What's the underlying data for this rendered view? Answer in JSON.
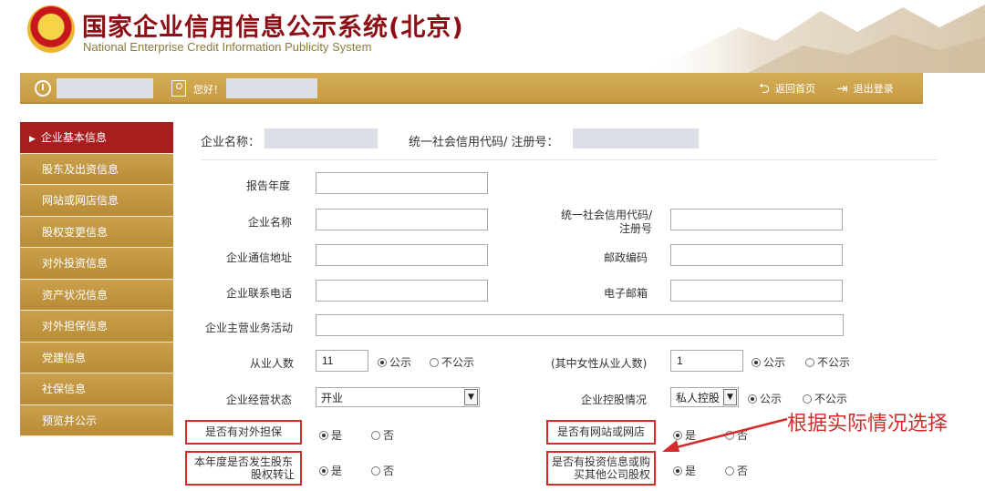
{
  "header": {
    "title_cn": "国家企业信用信息公示系统(北京)",
    "title_en": "National Enterprise Credit Information Publicity System"
  },
  "topbar": {
    "hello": "您好！",
    "home_label": "返回首页",
    "logout_label": "退出登录"
  },
  "sidebar": {
    "items": [
      {
        "label": "企业基本信息",
        "active": true
      },
      {
        "label": "股东及出资信息"
      },
      {
        "label": "网站或网店信息"
      },
      {
        "label": "股权变更信息"
      },
      {
        "label": "对外投资信息"
      },
      {
        "label": "资产状况信息"
      },
      {
        "label": "对外担保信息"
      },
      {
        "label": "党建信息"
      },
      {
        "label": "社保信息"
      },
      {
        "label": "预览并公示"
      }
    ]
  },
  "info": {
    "company_name_label": "企业名称：",
    "credit_code_label": "统一社会信用代码/ 注册号："
  },
  "form": {
    "report_year": {
      "label": "报告年度",
      "value": ""
    },
    "company_name": {
      "label": "企业名称",
      "value": ""
    },
    "credit_code": {
      "label_line1": "统一社会信用代码/",
      "label_line2": "注册号",
      "value": ""
    },
    "address": {
      "label": "企业通信地址",
      "value": ""
    },
    "postcode": {
      "label": "邮政编码",
      "value": ""
    },
    "phone": {
      "label": "企业联系电话",
      "value": ""
    },
    "email": {
      "label": "电子邮箱",
      "value": ""
    },
    "main_business": {
      "label": "企业主营业务活动",
      "value": ""
    },
    "employees": {
      "label": "从业人数",
      "value": "11",
      "public": "公示",
      "not_public": "不公示"
    },
    "female_employees": {
      "label": "(其中女性从业人数)",
      "value": "1",
      "public": "公示",
      "not_public": "不公示"
    },
    "status": {
      "label": "企业经营状态",
      "value": "开业"
    },
    "holding": {
      "label": "企业控股情况",
      "value": "私人控股",
      "public": "公示",
      "not_public": "不公示"
    },
    "guarantee": {
      "label": "是否有对外担保",
      "yes": "是",
      "no": "否"
    },
    "website": {
      "label": "是否有网站或网店",
      "yes": "是",
      "no": "否"
    },
    "equity_transfer": {
      "label_line1": "本年度是否发生股东",
      "label_line2": "股权转让",
      "yes": "是",
      "no": "否"
    },
    "investment": {
      "label_line1": "是否有投资信息或购",
      "label_line2": "买其他公司股权",
      "yes": "是",
      "no": "否"
    }
  },
  "annotation": {
    "text": "根据实际情况选择",
    "color": "#d62b2b"
  }
}
